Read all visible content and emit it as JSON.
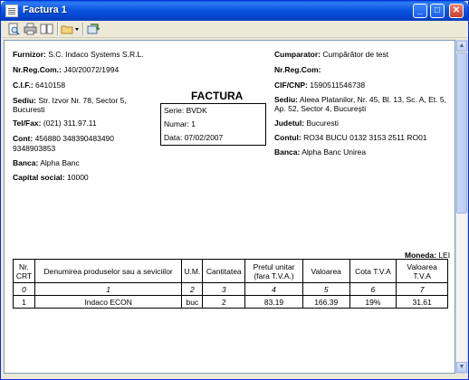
{
  "window": {
    "title": "Factura 1",
    "buttons": {
      "minimize": "_",
      "maximize": "□",
      "close": "✕"
    }
  },
  "toolbar": {
    "icons": [
      "print-preview-icon",
      "print-icon",
      "two-page-icon",
      "open-folder-icon",
      "export-icon"
    ]
  },
  "seller": {
    "furnizor_label": "Furnizor:",
    "furnizor": "S.C. Indaco Systems S.R.L.",
    "nrreg_label": "Nr.Reg.Com.:",
    "nrreg": "J40/20072/1994",
    "cif_label": "C.I.F.:",
    "cif": "6410158",
    "sediu_label": "Sediu:",
    "sediu_1": "Str. Izvor Nr. 78, Sector 5,",
    "sediu_2": "Bucuresti",
    "telfax_label": "Tel/Fax:",
    "telfax": "(021) 311.97.11",
    "cont_label": "Cont:",
    "cont_1": "456880 348390483490",
    "cont_2": "9348903853",
    "banca_label": "Banca:",
    "banca": "Alpha Banc",
    "capital_label": "Capital social:",
    "capital": "10000"
  },
  "invoice": {
    "title": "FACTURA",
    "serie_label": "Serie:",
    "serie": "BVDK",
    "numar_label": "Numar:",
    "numar": "1",
    "data_label": "Data:",
    "data": "07/02/2007"
  },
  "buyer": {
    "cumparator_label": "Cumparator:",
    "cumparator": "Cumpărător de test",
    "nrreg_label": "Nr.Reg.Com:",
    "nrreg": "",
    "cifcnp_label": "CIF/CNP:",
    "cifcnp": "1590511546738",
    "sediu_label": "Sediu:",
    "sediu_1": "Aleea Platanilor, Nr. 45, Bl. 13, Sc. A, Et. 5,",
    "sediu_2": "Ap. 52, Sector 4, București",
    "judet_label": "Judetul:",
    "judet": "Bucuresti",
    "contul_label": "Contul:",
    "contul": "RO34 BUCU 0132 3153 2511 RO01",
    "banca_label": "Banca:",
    "banca": "Alpha Banc Unirea"
  },
  "moneda": {
    "label": "Moneda:",
    "value": "LEI"
  },
  "table": {
    "headers": {
      "nr_1": "Nr.",
      "nr_2": "CRT",
      "denumire": "Denumirea produselor sau a seviciilor",
      "um": "U.M.",
      "cantitate": "Cantitatea",
      "pret_1": "Pretul unitar",
      "pret_2": "(fara T.V.A.)",
      "valoare": "Valoarea",
      "cota": "Cota T.V.A",
      "valtva_1": "Valoarea",
      "valtva_2": "T.V.A"
    },
    "index_row": [
      "0",
      "1",
      "2",
      "3",
      "4",
      "5",
      "6",
      "7"
    ],
    "rows": [
      [
        "1",
        "Indaco ECON",
        "buc",
        "2",
        "83.19",
        "166.39",
        "19%",
        "31.61"
      ]
    ]
  }
}
